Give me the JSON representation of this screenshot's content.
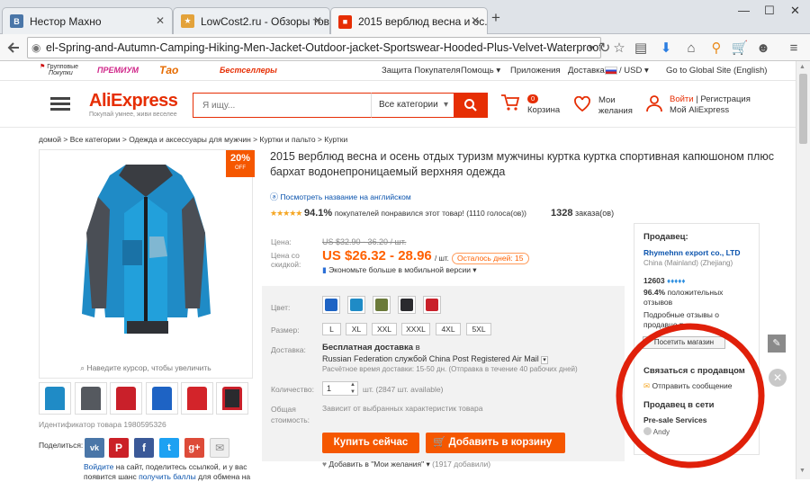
{
  "browser": {
    "tabs": [
      {
        "label": "Нестор Махно",
        "favicon_letter": "В"
      },
      {
        "label": "LowCost2.ru - Обзоры тов...",
        "favicon_letter": ""
      },
      {
        "label": "2015 верблюд весна и ос...",
        "favicon_letter": ""
      }
    ],
    "new_tab": "+",
    "url": "el-Spring-and-Autumn-Camping-Hiking-Men-Jacket-Outdoor-jacket-Sportswear-Hooded-Plus-Velvet-Waterproof/1980595326.htm"
  },
  "topstrip": {
    "promo1_line1": "Групповые",
    "promo1_line2": "Покупки",
    "promo2": "ПРЕМИУМ",
    "promo3": "Тао",
    "promo4": "Бестселлеры",
    "links": [
      "Защита Покупателя",
      "Помощь ▾",
      "Приложения",
      "Доставка в",
      "/ USD ▾",
      "Go to Global Site (English)"
    ]
  },
  "header": {
    "logo": "AliExpress",
    "tagline": "Покупай умнее, живи веселее",
    "search_placeholder": "Я ищу...",
    "category_select": "Все категории",
    "cart_count": "0",
    "cart_label": "Корзина",
    "wishlist_line1": "Мои",
    "wishlist_line2": "желания",
    "signin": "Войти",
    "register": "| Регистрация",
    "my_account": "Мой AliExpress"
  },
  "breadcrumb": "домой > Все категории > Одежда и аксессуары для мужчин > Куртки и пальто > Куртки",
  "gallery": {
    "discount_pct": "20%",
    "discount_off": "OFF",
    "zoom_hint": "Наведите курсор, чтобы увеличить",
    "product_id": "Идентификатор товара 1980595326",
    "share_label": "Поделиться:",
    "share_text_link": "Войдите",
    "share_text_line1": " на сайт, поделитесь ссылкой, и у вас",
    "share_text_line2_start": "появится шанс ",
    "share_text_line2_link": "получить баллы",
    "share_text_line2_end": " для обмена на"
  },
  "product": {
    "title": "2015 верблюд весна и осень отдых туризм мужчины куртка куртка спортивная капюшоном плюс бархат водонепроницаемый верхняя одежда",
    "translate_link": "Посмотреть название на английском",
    "rating_pct": "94.1%",
    "rating_text": "покупателей понравился этот товар! (1110 голоса(ов))",
    "orders_count": "1328",
    "orders_label": "заказа(ов)",
    "price_label": "Цена:",
    "old_price": "US $32.90 - 36.20 / шт.",
    "discount_label_1": "Цена со",
    "discount_label_2": "скидкой:",
    "new_price": "US $26.32 - 28.96",
    "price_unit": "/ шт.",
    "days_left": "Осталось дней: 15",
    "mobile_save": "Экономьте больше в мобильной версии ▾",
    "color_label": "Цвет:",
    "size_label": "Размер:",
    "sizes": [
      "L",
      "XL",
      "XXL",
      "XXXL",
      "4XL",
      "5XL"
    ],
    "shipping_label": "Доставка:",
    "shipping_free": "Бесплатная доставка",
    "shipping_in": "в",
    "shipping_method": "Russian Federation службой China Post Registered Air Mail",
    "shipping_time": "Расчётное время доставки: 15-50 дн. (Отправка в течение 40 рабочих дней)",
    "qty_label": "Количество:",
    "qty_value": "1",
    "qty_avail": "шт. (2847 шт. available)",
    "total_label_1": "Общая",
    "total_label_2": "стоимость:",
    "total_value": "Зависит от выбранных характеристик товара",
    "buy_now": "Купить сейчас",
    "add_cart": "Добавить в корзину",
    "wishlist_add": "Добавить в \"Мои желания\" ▾",
    "wishlist_count": "(1917 добавили)"
  },
  "seller": {
    "heading": "Продавец:",
    "name": "Rhymehnn export co., LTD",
    "location": "China (Mainland) (Zhejiang)",
    "score": "12603",
    "positive_pct": "96.4%",
    "positive_text_1": "положительных",
    "positive_text_2": "отзывов",
    "details_1": "Подробные отзывы о",
    "details_2": "продавце ▾",
    "visit_store": "Посетить магазин",
    "contact_heading": "Связаться с продавцом",
    "send_message": "Отправить сообщение",
    "online_heading": "Продавец в сети",
    "presale": "Pre-sale Services",
    "agent": "Andy"
  },
  "colors": {
    "ali_red": "#e62e04",
    "orange": "#f55700",
    "price_orange": "#ff6000",
    "annotation_red": "#e0200a",
    "link_blue": "#0a53ad"
  }
}
